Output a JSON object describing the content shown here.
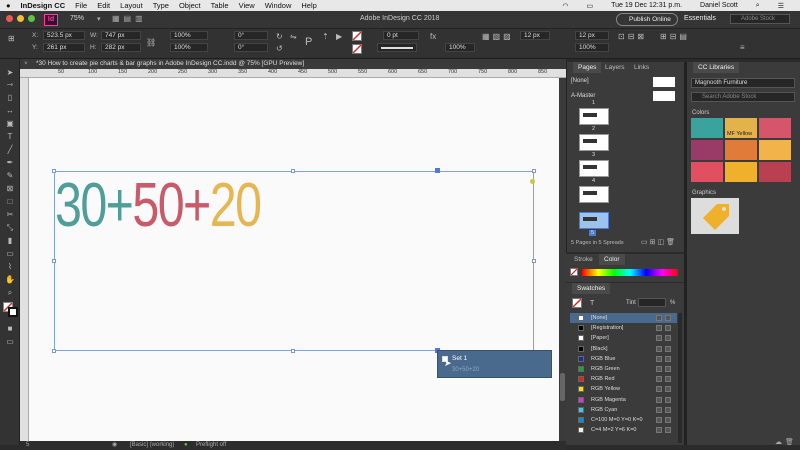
{
  "menubar": {
    "apple": "",
    "items": [
      "InDesign CC",
      "File",
      "Edit",
      "Layout",
      "Type",
      "Object",
      "Table",
      "View",
      "Window",
      "Help"
    ],
    "clock": "Tue 19 Dec  12:31 p.m.",
    "user": "Daniel Scott"
  },
  "appbar": {
    "zoom": "75%",
    "title": "Adobe InDesign CC 2018",
    "publish": "Publish Online",
    "workspace": "Essentials",
    "search_placeholder": "Adobe Stock"
  },
  "control": {
    "x_label": "X:",
    "x": "523.5 px",
    "y_label": "Y:",
    "y": "261 px",
    "w_label": "W:",
    "w": "747 px",
    "h_label": "H:",
    "h": "282 px",
    "scale_x": "100%",
    "scale_y": "100%",
    "rotate": "0°",
    "shear": "0°",
    "stroke_weight": "0 pt",
    "opacity": "100%",
    "gap": "12 px",
    "gutter": "12 px",
    "ref_w": "100%",
    "ref_h": "100%"
  },
  "document": {
    "tab": "*30 How to create pie charts & bar graphs in Adobe InDesign CC.indd @ 75% [GPU Preview]",
    "ruler_ticks": [
      "50",
      "100",
      "150",
      "200",
      "250",
      "300",
      "350",
      "400",
      "450",
      "500",
      "550",
      "600",
      "650",
      "700",
      "750",
      "800",
      "850",
      "900"
    ],
    "headline": [
      {
        "text": "30",
        "color": "#4f9e9a"
      },
      {
        "text": "+",
        "color": "#4f9e9a"
      },
      {
        "text": "50",
        "color": "#c85a6a"
      },
      {
        "text": "+",
        "color": "#c85a6a"
      },
      {
        "text": "20",
        "color": "#e6b653"
      }
    ],
    "popup_title": "Set 1",
    "popup_value": "30+50+20"
  },
  "status": {
    "page": "5",
    "style": "[Basic] (working)",
    "preflight": "Preflight off"
  },
  "pages": {
    "tabs": [
      "Pages",
      "Layers",
      "Links"
    ],
    "none": "[None]",
    "master": "A-Master",
    "page_numbers": [
      "1",
      "2",
      "3",
      "4",
      "5"
    ],
    "footer": "5 Pages in 5 Spreads"
  },
  "color": {
    "tabs": [
      "Stroke",
      "Color"
    ]
  },
  "swatches": {
    "title": "Swatches",
    "tint_label": "Tint",
    "tint_unit": "%",
    "items": [
      {
        "name": "[None]",
        "color": "#ffffff"
      },
      {
        "name": "[Registration]",
        "color": "#000000"
      },
      {
        "name": "[Paper]",
        "color": "#ffffff"
      },
      {
        "name": "[Black]",
        "color": "#000000"
      },
      {
        "name": "RGB Blue",
        "color": "#1d2aa5"
      },
      {
        "name": "RGB Green",
        "color": "#1fa33a"
      },
      {
        "name": "RGB Red",
        "color": "#e2231a"
      },
      {
        "name": "RGB Yellow",
        "color": "#f5e400"
      },
      {
        "name": "RGB Magenta",
        "color": "#d23bd0"
      },
      {
        "name": "RGB Cyan",
        "color": "#40c8e8"
      },
      {
        "name": "C=100 M=0 Y=0 K=0",
        "color": "#0093d8"
      },
      {
        "name": "C=4 M=2 Y=6 K=0",
        "color": "#f2f1ec"
      }
    ]
  },
  "libraries": {
    "title": "CC Libraries",
    "library": "Magnooth Furniture",
    "search_placeholder": "Search Adobe Stock",
    "colors_label": "Colors",
    "highlight_label": "MF Yellow",
    "colors": [
      "#3aa39e",
      "#e3b24b",
      "#d5566a",
      "#993a67",
      "#e07b39",
      "#f1b34a",
      "#e05060",
      "#efb02c",
      "#b84050"
    ],
    "graphics_label": "Graphics"
  }
}
